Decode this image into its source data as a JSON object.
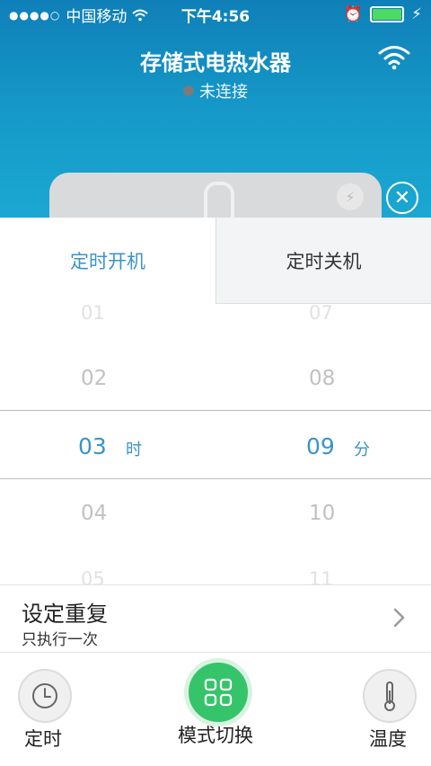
{
  "status_bar": {
    "carrier": "中国移动",
    "time": "下午4:56",
    "battery_color": "#4cd964"
  },
  "header": {
    "title": "存储式电热水器",
    "connection_status": "未连接",
    "icons": [
      "wifi-icon",
      "bolt-icon",
      "close-icon"
    ]
  },
  "tabs": [
    {
      "label": "定时开机",
      "active": true
    },
    {
      "label": "定时关机",
      "active": false
    }
  ],
  "picker": {
    "hours": [
      "01",
      "02",
      "03",
      "04",
      "05"
    ],
    "minutes": [
      "07",
      "08",
      "09",
      "10",
      "11"
    ],
    "selected_hour": "03",
    "selected_minute": "09",
    "hour_unit": "时",
    "minute_unit": "分"
  },
  "repeat": {
    "title": "设定重复",
    "value": "只执行一次"
  },
  "bottom_bar": {
    "timer_label": "定时",
    "mode_label": "模式切换",
    "temperature_label": "温度",
    "mode_accent": "#35c46a"
  },
  "colors": {
    "header_blue": "#169bc9",
    "accent": "#3a93c9"
  }
}
